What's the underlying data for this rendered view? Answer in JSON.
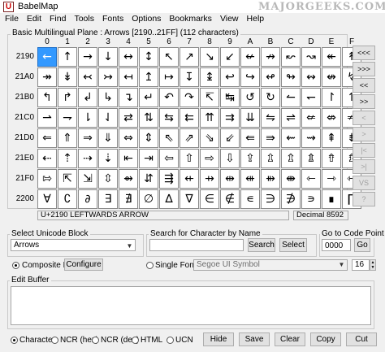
{
  "window": {
    "title": "BabelMap",
    "icon_letter": "U"
  },
  "watermark": "MAJORGEEKS.COM",
  "menu": [
    "File",
    "Edit",
    "Find",
    "Tools",
    "Fonts",
    "Options",
    "Bookmarks",
    "View",
    "Help"
  ],
  "grid": {
    "legend": "Basic Multilingual Plane : Arrows [2190..21FF] (112 characters)",
    "columns": [
      "0",
      "1",
      "2",
      "3",
      "4",
      "5",
      "6",
      "7",
      "8",
      "9",
      "A",
      "B",
      "C",
      "D",
      "E",
      "F"
    ],
    "rows": [
      {
        "label": "2190",
        "chars": [
          "←",
          "↑",
          "→",
          "↓",
          "↔",
          "↕",
          "↖",
          "↗",
          "↘",
          "↙",
          "↚",
          "↛",
          "↜",
          "↝",
          "↞",
          "↟"
        ]
      },
      {
        "label": "21A0",
        "chars": [
          "↠",
          "↡",
          "↢",
          "↣",
          "↤",
          "↥",
          "↦",
          "↧",
          "↨",
          "↩",
          "↪",
          "↫",
          "↬",
          "↭",
          "↮",
          "↯"
        ]
      },
      {
        "label": "21B0",
        "chars": [
          "↰",
          "↱",
          "↲",
          "↳",
          "↴",
          "↵",
          "↶",
          "↷",
          "↸",
          "↹",
          "↺",
          "↻",
          "↼",
          "↽",
          "↾",
          "↿"
        ]
      },
      {
        "label": "21C0",
        "chars": [
          "⇀",
          "⇁",
          "⇂",
          "⇃",
          "⇄",
          "⇅",
          "⇆",
          "⇇",
          "⇈",
          "⇉",
          "⇊",
          "⇋",
          "⇌",
          "⇍",
          "⇎",
          "⇏"
        ]
      },
      {
        "label": "21D0",
        "chars": [
          "⇐",
          "⇑",
          "⇒",
          "⇓",
          "⇔",
          "⇕",
          "⇖",
          "⇗",
          "⇘",
          "⇙",
          "⇚",
          "⇛",
          "⇜",
          "⇝",
          "⇞",
          "⇟"
        ]
      },
      {
        "label": "21E0",
        "chars": [
          "⇠",
          "⇡",
          "⇢",
          "⇣",
          "⇤",
          "⇥",
          "⇦",
          "⇧",
          "⇨",
          "⇩",
          "⇪",
          "⇫",
          "⇬",
          "⇭",
          "⇮",
          "⇯"
        ]
      },
      {
        "label": "21F0",
        "chars": [
          "⇰",
          "⇱",
          "⇲",
          "⇳",
          "⇴",
          "⇵",
          "⇶",
          "⇷",
          "⇸",
          "⇹",
          "⇺",
          "⇻",
          "⇼",
          "⇽",
          "⇾",
          "⇿"
        ]
      },
      {
        "label": "2200",
        "chars": [
          "∀",
          "∁",
          "∂",
          "∃",
          "∄",
          "∅",
          "∆",
          "∇",
          "∈",
          "∉",
          "∊",
          "∋",
          "∌",
          "∍",
          "∎",
          "∏"
        ]
      }
    ],
    "selected": {
      "row": 0,
      "col": 0
    }
  },
  "nav_buttons": [
    "<<<",
    ">>>",
    "<<",
    ">>",
    "<",
    ">",
    "|<",
    ">|",
    "VS",
    "?"
  ],
  "status": {
    "char_name": "U+2190 LEFTWARDS ARROW",
    "decimal": "Decimal 8592"
  },
  "unicode_block": {
    "legend": "Select Unicode Block",
    "value": "Arrows"
  },
  "search": {
    "legend": "Search for Character by Name",
    "value": "",
    "search_label": "Search",
    "select_label": "Select"
  },
  "goto": {
    "legend": "Go to Code Point",
    "value": "0000",
    "go_label": "Go"
  },
  "font": {
    "composite_label": "Composite Font",
    "configure_label": "Configure",
    "single_label": "Single Font",
    "font_name": "Segoe UI Symbol",
    "size": "16"
  },
  "edit_buffer": {
    "legend": "Edit Buffer",
    "value": ""
  },
  "bottom": {
    "radios": [
      "Character",
      "NCR (hex)",
      "NCR (dec)",
      "HTML",
      "UCN"
    ],
    "selected_radio": 0,
    "buttons": [
      "Hide",
      "Save",
      "Clear",
      "Copy",
      "Cut"
    ]
  }
}
